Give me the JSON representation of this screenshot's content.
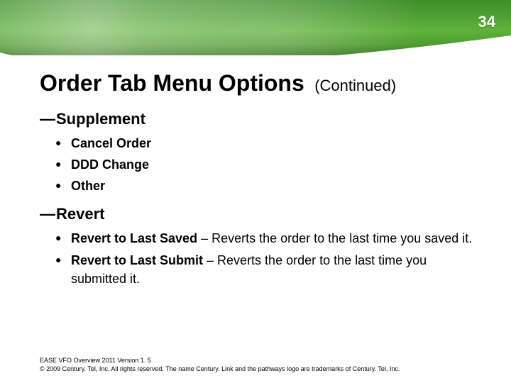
{
  "page_number": "34",
  "title": {
    "main": "Order Tab Menu Options",
    "continued": "(Continued)"
  },
  "sections": {
    "supplement": {
      "heading": "Supplement",
      "items": [
        "Cancel Order",
        "DDD Change",
        "Other"
      ]
    },
    "revert": {
      "heading": "Revert",
      "items": [
        {
          "label": "Revert to Last Saved",
          "desc": " – Reverts the order to the last time you saved it."
        },
        {
          "label": "Revert to Last Submit",
          "desc": " – Reverts the order to the last time you submitted it."
        }
      ]
    }
  },
  "footer": {
    "line1": "EASE VFO Overview 2011 Version 1. 5",
    "line2": "© 2009 Century. Tel, Inc. All rights reserved. The name Century. Link and the pathways logo are trademarks of Century. Tel, Inc."
  }
}
